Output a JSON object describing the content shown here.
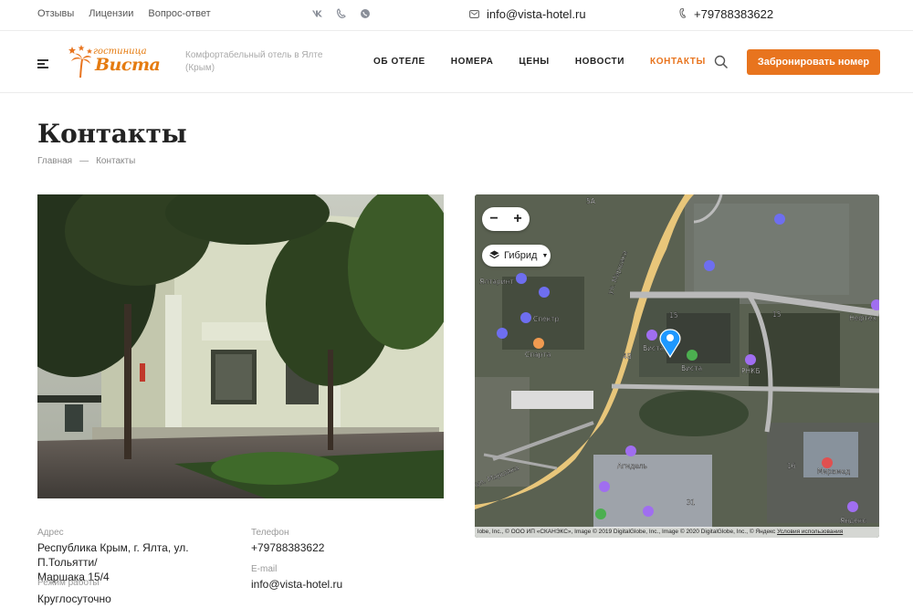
{
  "topbar": {
    "links": [
      "Отзывы",
      "Лицензии",
      "Вопрос-ответ"
    ],
    "socials": [
      "vk-icon",
      "viber-icon",
      "whatsapp-icon"
    ],
    "email": "info@vista-hotel.ru",
    "phone": "+79788383622"
  },
  "header": {
    "logo_top": "гостиница",
    "logo_main": "Виста",
    "tagline": "Комфортабельный отель в Ялте (Крым)",
    "nav": [
      "ОБ ОТЕЛЕ",
      "НОМЕРА",
      "ЦЕНЫ",
      "НОВОСТИ",
      "КОНТАКТЫ"
    ],
    "active_nav": "КОНТАКТЫ",
    "book_button": "Забронировать номер"
  },
  "page": {
    "title": "Контакты",
    "breadcrumb": [
      "Главная",
      "—",
      "Контакты"
    ]
  },
  "map": {
    "zoom_in": "+",
    "zoom_out": "−",
    "layer_label": "Гибрид",
    "attribution": "lobe, Inc., © ООО ИП «СКАНЭКС», Image © 2019 DigitalGlobe, Inc., Image © 2020 DigitalGlobe, Inc., © Яндекс",
    "terms": "Условия использования",
    "labels": [
      "Ялтаринт",
      "Спектр",
      "Спарта",
      "Виста",
      "Виста",
      "РНКБ",
      "Агидель",
      "Мирамед",
      "Нефтех Башки",
      "ул. Маршака",
      "ул. Маршака",
      "15",
      "15",
      "16",
      "4В",
      "31",
      "5А",
      "Яндекс"
    ]
  },
  "contacts": {
    "address_label": "Адрес",
    "address_line1": "Республика Крым, г. Ялта, ул. П.Тольятти/",
    "address_line2": "Маршака 15/4",
    "hours_label": "Режим работы",
    "hours": "Круглосуточно",
    "phone_label": "Телефон",
    "phone": "+79788383622",
    "email_label": "E-mail",
    "email": "info@vista-hotel.ru"
  },
  "colors": {
    "accent": "#e8741e",
    "text": "#222222",
    "muted": "#999999"
  }
}
